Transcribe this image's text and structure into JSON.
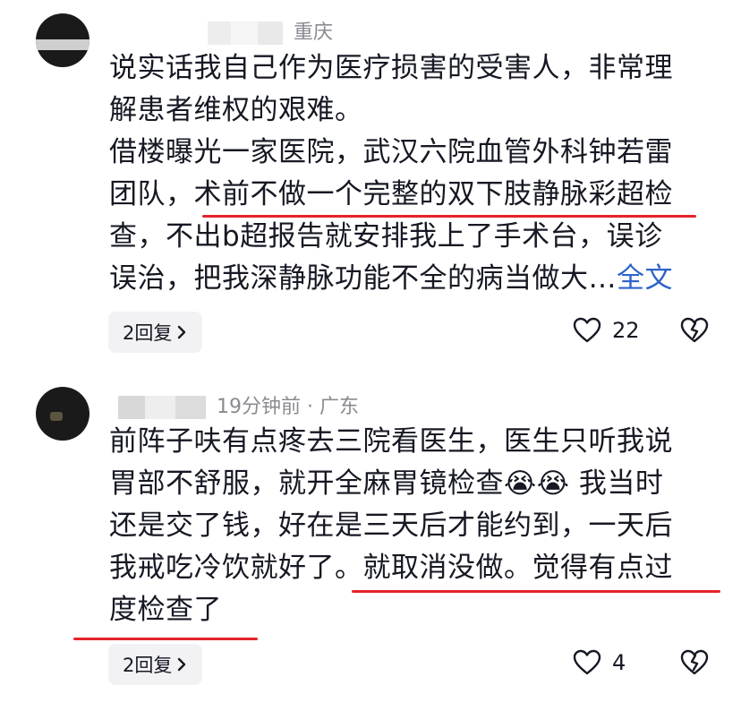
{
  "comments": [
    {
      "location": "重庆",
      "text_lines": [
        "说实话我自己作为医疗损害的受害人，非常理",
        "解患者维权的艰难。",
        "借楼曝光一家医院，武汉六院血管外科钟若雷",
        "团队，术前不做一个完整的双下肢静脉彩超检",
        "查，不出b超报告就安排我上了手术台，误诊",
        "误治，把我深静脉功能不全的病当做大…"
      ],
      "more_label": "全文",
      "reply_label": "2回复",
      "like_count": "22"
    },
    {
      "time_location": "19分钟前 · 广东",
      "text_lines": [
        "前阵子呋有点疼去三院看医生，医生只听我说",
        "胃部不舒服，就开全麻胃镜检查",
        "还是交了钱，好在是三天后才能约到，一天后",
        "我戒吃冷饮就好了。就取消没做。觉得有点过",
        "度检查了"
      ],
      "line2_suffix": "我当时",
      "emoji": [
        "😭",
        "😭"
      ],
      "reply_label": "2回复",
      "like_count": "4"
    }
  ],
  "colors": {
    "link": "#2e63c9",
    "highlight_underline": "#e5232a",
    "meta_gray": "#8a8b91",
    "reply_bg": "#f2f2f4"
  },
  "icons": [
    "heart-icon",
    "broken-heart-icon",
    "chevron-right-icon"
  ]
}
